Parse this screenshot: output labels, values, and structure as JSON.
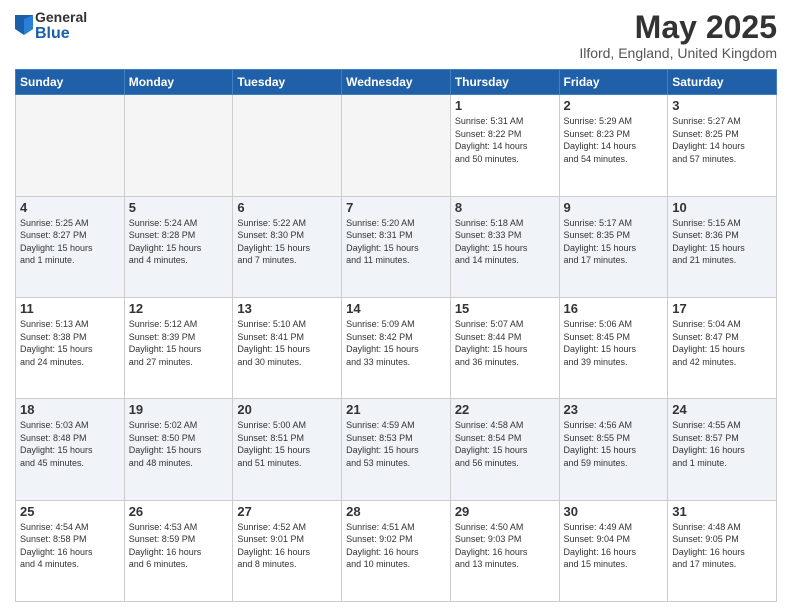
{
  "logo": {
    "general": "General",
    "blue": "Blue"
  },
  "title": "May 2025",
  "location": "Ilford, England, United Kingdom",
  "weekdays": [
    "Sunday",
    "Monday",
    "Tuesday",
    "Wednesday",
    "Thursday",
    "Friday",
    "Saturday"
  ],
  "weeks": [
    [
      {
        "day": "",
        "info": ""
      },
      {
        "day": "",
        "info": ""
      },
      {
        "day": "",
        "info": ""
      },
      {
        "day": "",
        "info": ""
      },
      {
        "day": "1",
        "info": "Sunrise: 5:31 AM\nSunset: 8:22 PM\nDaylight: 14 hours\nand 50 minutes."
      },
      {
        "day": "2",
        "info": "Sunrise: 5:29 AM\nSunset: 8:23 PM\nDaylight: 14 hours\nand 54 minutes."
      },
      {
        "day": "3",
        "info": "Sunrise: 5:27 AM\nSunset: 8:25 PM\nDaylight: 14 hours\nand 57 minutes."
      }
    ],
    [
      {
        "day": "4",
        "info": "Sunrise: 5:25 AM\nSunset: 8:27 PM\nDaylight: 15 hours\nand 1 minute."
      },
      {
        "day": "5",
        "info": "Sunrise: 5:24 AM\nSunset: 8:28 PM\nDaylight: 15 hours\nand 4 minutes."
      },
      {
        "day": "6",
        "info": "Sunrise: 5:22 AM\nSunset: 8:30 PM\nDaylight: 15 hours\nand 7 minutes."
      },
      {
        "day": "7",
        "info": "Sunrise: 5:20 AM\nSunset: 8:31 PM\nDaylight: 15 hours\nand 11 minutes."
      },
      {
        "day": "8",
        "info": "Sunrise: 5:18 AM\nSunset: 8:33 PM\nDaylight: 15 hours\nand 14 minutes."
      },
      {
        "day": "9",
        "info": "Sunrise: 5:17 AM\nSunset: 8:35 PM\nDaylight: 15 hours\nand 17 minutes."
      },
      {
        "day": "10",
        "info": "Sunrise: 5:15 AM\nSunset: 8:36 PM\nDaylight: 15 hours\nand 21 minutes."
      }
    ],
    [
      {
        "day": "11",
        "info": "Sunrise: 5:13 AM\nSunset: 8:38 PM\nDaylight: 15 hours\nand 24 minutes."
      },
      {
        "day": "12",
        "info": "Sunrise: 5:12 AM\nSunset: 8:39 PM\nDaylight: 15 hours\nand 27 minutes."
      },
      {
        "day": "13",
        "info": "Sunrise: 5:10 AM\nSunset: 8:41 PM\nDaylight: 15 hours\nand 30 minutes."
      },
      {
        "day": "14",
        "info": "Sunrise: 5:09 AM\nSunset: 8:42 PM\nDaylight: 15 hours\nand 33 minutes."
      },
      {
        "day": "15",
        "info": "Sunrise: 5:07 AM\nSunset: 8:44 PM\nDaylight: 15 hours\nand 36 minutes."
      },
      {
        "day": "16",
        "info": "Sunrise: 5:06 AM\nSunset: 8:45 PM\nDaylight: 15 hours\nand 39 minutes."
      },
      {
        "day": "17",
        "info": "Sunrise: 5:04 AM\nSunset: 8:47 PM\nDaylight: 15 hours\nand 42 minutes."
      }
    ],
    [
      {
        "day": "18",
        "info": "Sunrise: 5:03 AM\nSunset: 8:48 PM\nDaylight: 15 hours\nand 45 minutes."
      },
      {
        "day": "19",
        "info": "Sunrise: 5:02 AM\nSunset: 8:50 PM\nDaylight: 15 hours\nand 48 minutes."
      },
      {
        "day": "20",
        "info": "Sunrise: 5:00 AM\nSunset: 8:51 PM\nDaylight: 15 hours\nand 51 minutes."
      },
      {
        "day": "21",
        "info": "Sunrise: 4:59 AM\nSunset: 8:53 PM\nDaylight: 15 hours\nand 53 minutes."
      },
      {
        "day": "22",
        "info": "Sunrise: 4:58 AM\nSunset: 8:54 PM\nDaylight: 15 hours\nand 56 minutes."
      },
      {
        "day": "23",
        "info": "Sunrise: 4:56 AM\nSunset: 8:55 PM\nDaylight: 15 hours\nand 59 minutes."
      },
      {
        "day": "24",
        "info": "Sunrise: 4:55 AM\nSunset: 8:57 PM\nDaylight: 16 hours\nand 1 minute."
      }
    ],
    [
      {
        "day": "25",
        "info": "Sunrise: 4:54 AM\nSunset: 8:58 PM\nDaylight: 16 hours\nand 4 minutes."
      },
      {
        "day": "26",
        "info": "Sunrise: 4:53 AM\nSunset: 8:59 PM\nDaylight: 16 hours\nand 6 minutes."
      },
      {
        "day": "27",
        "info": "Sunrise: 4:52 AM\nSunset: 9:01 PM\nDaylight: 16 hours\nand 8 minutes."
      },
      {
        "day": "28",
        "info": "Sunrise: 4:51 AM\nSunset: 9:02 PM\nDaylight: 16 hours\nand 10 minutes."
      },
      {
        "day": "29",
        "info": "Sunrise: 4:50 AM\nSunset: 9:03 PM\nDaylight: 16 hours\nand 13 minutes."
      },
      {
        "day": "30",
        "info": "Sunrise: 4:49 AM\nSunset: 9:04 PM\nDaylight: 16 hours\nand 15 minutes."
      },
      {
        "day": "31",
        "info": "Sunrise: 4:48 AM\nSunset: 9:05 PM\nDaylight: 16 hours\nand 17 minutes."
      }
    ]
  ]
}
